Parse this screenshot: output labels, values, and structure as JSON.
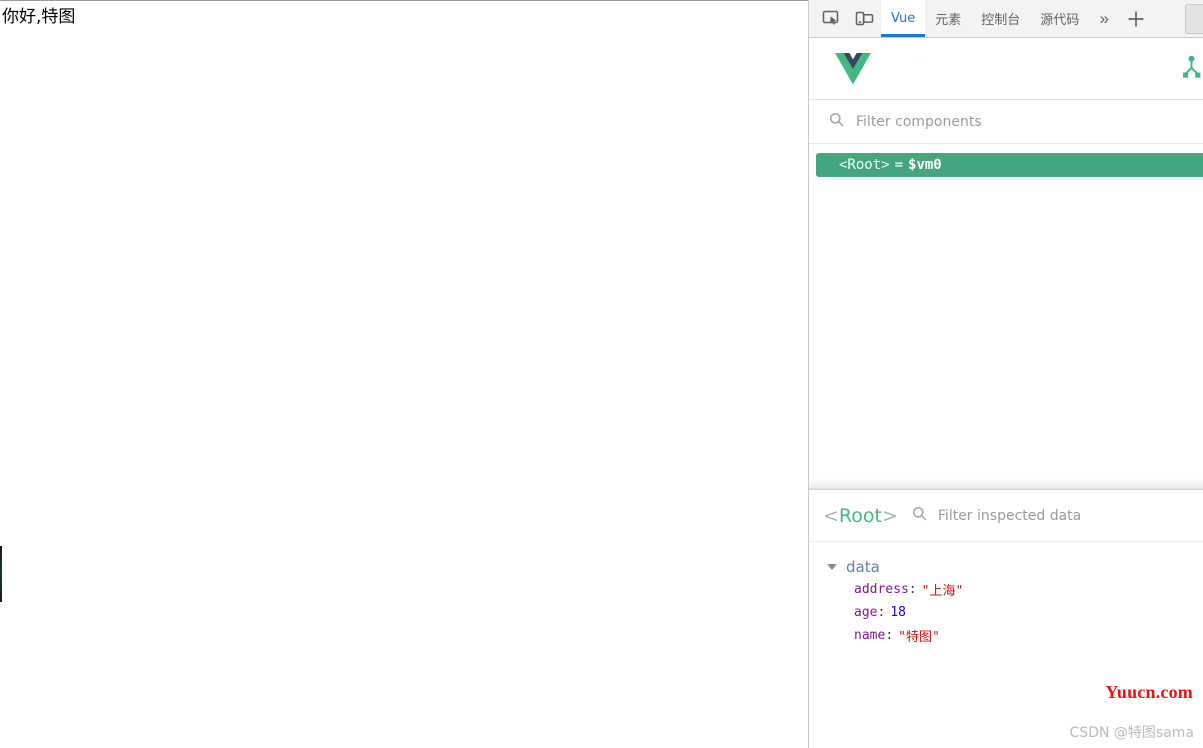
{
  "page": {
    "body_text": "你好,特图"
  },
  "devtools": {
    "toolbar": {
      "inspect_icon": "inspect-element-icon",
      "device_icon": "device-toolbar-icon",
      "more_label": "»",
      "plus_label": "+",
      "tabs": [
        {
          "label": "Vue",
          "active": true
        },
        {
          "label": "元素",
          "active": false
        },
        {
          "label": "控制台",
          "active": false
        },
        {
          "label": "源代码",
          "active": false
        }
      ]
    },
    "vue_panel": {
      "logo_icon": "vue-logo-icon",
      "tree_toggle_icon": "component-tree-icon",
      "component_filter": {
        "icon": "search-icon",
        "placeholder": "Filter components",
        "value": ""
      },
      "tree": {
        "selected_row": {
          "tag_open": "<Root>",
          "equals": "=",
          "ref": "$vm0"
        }
      },
      "inspector": {
        "bracket_open": "<",
        "component_name": "Root",
        "bracket_close": ">",
        "data_filter": {
          "icon": "search-icon",
          "placeholder": "Filter inspected data",
          "value": ""
        },
        "groups": [
          {
            "name": "data",
            "expanded": true,
            "rows": [
              {
                "key": "address",
                "value": "\"上海\"",
                "type": "string"
              },
              {
                "key": "age",
                "value": "18",
                "type": "number"
              },
              {
                "key": "name",
                "value": "\"特图\"",
                "type": "string"
              }
            ]
          }
        ]
      }
    }
  },
  "watermarks": {
    "site": "Yuucn.com",
    "credit": "CSDN @特图sama"
  },
  "colors": {
    "vue_green": "#42b883",
    "row_green": "#44a67f",
    "tab_blue": "#1a73e8",
    "string_red": "#c41a16",
    "number_blue": "#1c00cf",
    "key_purple": "#881391",
    "watermark_red": "#ee1111"
  }
}
